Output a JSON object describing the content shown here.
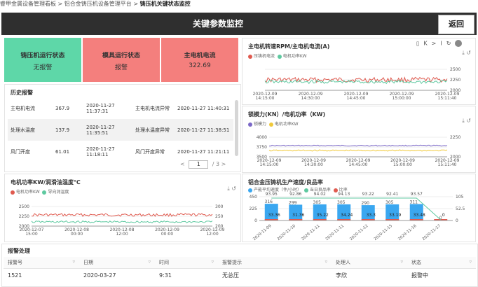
{
  "breadcrumb": {
    "part1": "睿甲金属设备管理看板",
    "sep1": ">",
    "part2": "铝合金铸压机设备管理平台",
    "sep2": ">",
    "part3": "铸压机关键状态监控"
  },
  "header": {
    "title": "关键参数监控",
    "back_label": "返回"
  },
  "status_cards": [
    {
      "title": "铸压机运行状态",
      "value": "无报警",
      "color": "#5ed7a8"
    },
    {
      "title": "模具运行状态",
      "value": "报警",
      "color": "#f47f7d"
    },
    {
      "title": "主电机电流",
      "value": "322.69",
      "color": "#f47f7d"
    }
  ],
  "history": {
    "title": "历史报警",
    "rows": [
      {
        "name": "主电机电流",
        "value": "367.9",
        "start": "2020-11-27 11:37:31",
        "type": "主电机电流异常",
        "end": "2020-11-27 11:40:31"
      },
      {
        "name": "处理水温度",
        "value": "137.9",
        "start": "2020-11-27 11:35:51",
        "type": "处理水温度异常",
        "end": "2020-11-27 11:38:51"
      },
      {
        "name": "风门开度",
        "value": "61.01",
        "start": "2020-11-27 11:18:11",
        "type": "风门开度异常",
        "end": "2020-11-27 11:21:11"
      }
    ],
    "page": "1",
    "total_pages": "/ 3"
  },
  "chart1": {
    "title": "主电机转速RPM/主电机电流(A)",
    "legend": [
      "压铸机电流",
      "电机功率KW"
    ],
    "colors": [
      "#e05a4f",
      "#5ec9a0"
    ],
    "yticks": [
      "2500",
      "2250",
      "2000"
    ],
    "xticks": [
      "2020-12-09\n14:15:00",
      "2020-12-09\n14:30:00",
      "2020-12-09\n14:45:00",
      "2020-12-09\n15:00:00",
      "2020-12-09\n15:11:40"
    ]
  },
  "chart2": {
    "title": "锁模力(KN）/电机功率（KW)",
    "legend": [
      "锁模力",
      "电机功率KW"
    ],
    "colors": [
      "#7b68c7",
      "#f0c93a"
    ],
    "yticks_left": [
      "4000",
      "3750",
      "3500"
    ],
    "yticks_right": [
      "2250",
      "2000"
    ],
    "xticks": [
      "2020-12-09\n14:15:00",
      "2020-12-09\n14:30:00",
      "2020-12-09\n14:45:00",
      "2020-12-09\n15:00:00",
      "2020-12-09\n15:11:40"
    ]
  },
  "chart3": {
    "title": "电机功率KW/润滑油温度℃",
    "legend": [
      "电机功率KW",
      "导向润温度"
    ],
    "colors": [
      "#e05a4f",
      "#5ec9a0"
    ],
    "yticks_left": [
      "2500",
      "2250",
      "2000"
    ],
    "yticks_right": [
      "300",
      "250",
      "200"
    ],
    "xticks": [
      "2020-12-07\n15:00",
      "2020-12-08\n00:00",
      "2020-12-08\n12:00",
      "2020-12-09\n00:00",
      "2020-12-09\n12:00"
    ]
  },
  "chart_data": {
    "type": "bar",
    "title": "铝合金压铸机生产速度/良品率",
    "legend": [
      "产能平均速度（件/小时）",
      "当日良品率",
      "比率"
    ],
    "categories": [
      "2020-11-09",
      "2020-11-10",
      "2020-11-11",
      "2020-11-11",
      "2020-11-12",
      "2020-11-15",
      "2020-11-16",
      "2020-11-17"
    ],
    "series": [
      {
        "name": "产能平均速度（件/小时）",
        "values": [
          316,
          299,
          305,
          305,
          290,
          305,
          311,
          0
        ]
      },
      {
        "name": "当日良品率",
        "values": [
          93.95,
          92.86,
          94.02,
          94.13,
          93.22,
          92.41,
          93.57,
          0
        ]
      },
      {
        "name": "比率",
        "values": [
          33.36,
          31.36,
          35.22,
          34.24,
          33.3,
          33.19,
          33.48,
          0
        ]
      }
    ],
    "yticks_left": [
      "450",
      "225",
      "0"
    ],
    "yticks_right": [
      "105",
      "52.5",
      "0"
    ],
    "ylim": [
      0,
      450
    ],
    "colors": [
      "#3aa7f0",
      "#5ec9a0",
      "#e05a4f"
    ]
  },
  "alarm_table": {
    "title": "报警处理",
    "headers": [
      "报警号",
      "日期",
      "时间",
      "报警提示",
      "处理人",
      "状态"
    ],
    "rows": [
      [
        "1521",
        "2020-03-27",
        "9:31",
        "无总压",
        "李欣",
        "报警中"
      ]
    ]
  }
}
